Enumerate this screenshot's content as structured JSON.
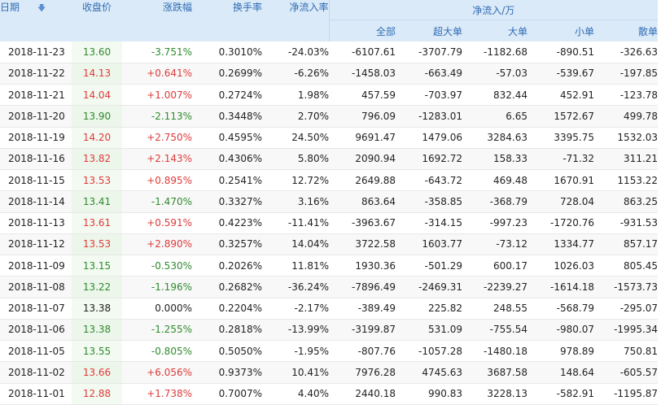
{
  "headers": {
    "date": "日期",
    "close": "收盘价",
    "change": "涨跌幅",
    "turnover": "换手率",
    "net_ratio": "净流入率",
    "net_group": "净流入/万",
    "all": "全部",
    "xl": "超大单",
    "l": "大单",
    "s": "小单",
    "retail": "散单"
  },
  "sort_icon": "down-arrow-icon",
  "colors": {
    "up": "#e03a3a",
    "down": "#2f8a2f",
    "header_bg": "#dbeaf8",
    "header_text": "#2f6cb4"
  },
  "rows": [
    {
      "date": "2018-11-23",
      "close": "13.60",
      "change": "-3.751%",
      "turnover": "0.3010%",
      "net_ratio": "-24.03%",
      "all": "-6107.61",
      "xl": "-3707.79",
      "l": "-1182.68",
      "s": "-890.51",
      "retail": "-326.63",
      "trend": "down"
    },
    {
      "date": "2018-11-22",
      "close": "14.13",
      "change": "+0.641%",
      "turnover": "0.2699%",
      "net_ratio": "-6.26%",
      "all": "-1458.03",
      "xl": "-663.49",
      "l": "-57.03",
      "s": "-539.67",
      "retail": "-197.85",
      "trend": "up"
    },
    {
      "date": "2018-11-21",
      "close": "14.04",
      "change": "+1.007%",
      "turnover": "0.2724%",
      "net_ratio": "1.98%",
      "all": "457.59",
      "xl": "-703.97",
      "l": "832.44",
      "s": "452.91",
      "retail": "-123.78",
      "trend": "up"
    },
    {
      "date": "2018-11-20",
      "close": "13.90",
      "change": "-2.113%",
      "turnover": "0.3448%",
      "net_ratio": "2.70%",
      "all": "796.09",
      "xl": "-1283.01",
      "l": "6.65",
      "s": "1572.67",
      "retail": "499.78",
      "trend": "down"
    },
    {
      "date": "2018-11-19",
      "close": "14.20",
      "change": "+2.750%",
      "turnover": "0.4595%",
      "net_ratio": "24.50%",
      "all": "9691.47",
      "xl": "1479.06",
      "l": "3284.63",
      "s": "3395.75",
      "retail": "1532.03",
      "trend": "up"
    },
    {
      "date": "2018-11-16",
      "close": "13.82",
      "change": "+2.143%",
      "turnover": "0.4306%",
      "net_ratio": "5.80%",
      "all": "2090.94",
      "xl": "1692.72",
      "l": "158.33",
      "s": "-71.32",
      "retail": "311.21",
      "trend": "up"
    },
    {
      "date": "2018-11-15",
      "close": "13.53",
      "change": "+0.895%",
      "turnover": "0.2541%",
      "net_ratio": "12.72%",
      "all": "2649.88",
      "xl": "-643.72",
      "l": "469.48",
      "s": "1670.91",
      "retail": "1153.22",
      "trend": "up"
    },
    {
      "date": "2018-11-14",
      "close": "13.41",
      "change": "-1.470%",
      "turnover": "0.3327%",
      "net_ratio": "3.16%",
      "all": "863.64",
      "xl": "-358.85",
      "l": "-368.79",
      "s": "728.04",
      "retail": "863.25",
      "trend": "down"
    },
    {
      "date": "2018-11-13",
      "close": "13.61",
      "change": "+0.591%",
      "turnover": "0.4223%",
      "net_ratio": "-11.41%",
      "all": "-3963.67",
      "xl": "-314.15",
      "l": "-997.23",
      "s": "-1720.76",
      "retail": "-931.53",
      "trend": "up"
    },
    {
      "date": "2018-11-12",
      "close": "13.53",
      "change": "+2.890%",
      "turnover": "0.3257%",
      "net_ratio": "14.04%",
      "all": "3722.58",
      "xl": "1603.77",
      "l": "-73.12",
      "s": "1334.77",
      "retail": "857.17",
      "trend": "up"
    },
    {
      "date": "2018-11-09",
      "close": "13.15",
      "change": "-0.530%",
      "turnover": "0.2026%",
      "net_ratio": "11.81%",
      "all": "1930.36",
      "xl": "-501.29",
      "l": "600.17",
      "s": "1026.03",
      "retail": "805.45",
      "trend": "down"
    },
    {
      "date": "2018-11-08",
      "close": "13.22",
      "change": "-1.196%",
      "turnover": "0.2682%",
      "net_ratio": "-36.24%",
      "all": "-7896.49",
      "xl": "-2469.31",
      "l": "-2239.27",
      "s": "-1614.18",
      "retail": "-1573.73",
      "trend": "down"
    },
    {
      "date": "2018-11-07",
      "close": "13.38",
      "change": "0.000%",
      "turnover": "0.2204%",
      "net_ratio": "-2.17%",
      "all": "-389.49",
      "xl": "225.82",
      "l": "248.55",
      "s": "-568.79",
      "retail": "-295.07",
      "trend": "flat"
    },
    {
      "date": "2018-11-06",
      "close": "13.38",
      "change": "-1.255%",
      "turnover": "0.2818%",
      "net_ratio": "-13.99%",
      "all": "-3199.87",
      "xl": "531.09",
      "l": "-755.54",
      "s": "-980.07",
      "retail": "-1995.34",
      "trend": "down"
    },
    {
      "date": "2018-11-05",
      "close": "13.55",
      "change": "-0.805%",
      "turnover": "0.5050%",
      "net_ratio": "-1.95%",
      "all": "-807.76",
      "xl": "-1057.28",
      "l": "-1480.18",
      "s": "978.89",
      "retail": "750.81",
      "trend": "down"
    },
    {
      "date": "2018-11-02",
      "close": "13.66",
      "change": "+6.056%",
      "turnover": "0.9373%",
      "net_ratio": "10.41%",
      "all": "7976.28",
      "xl": "4745.63",
      "l": "3687.58",
      "s": "148.64",
      "retail": "-605.57",
      "trend": "up"
    },
    {
      "date": "2018-11-01",
      "close": "12.88",
      "change": "+1.738%",
      "turnover": "0.7007%",
      "net_ratio": "4.40%",
      "all": "2440.18",
      "xl": "990.83",
      "l": "3228.13",
      "s": "-582.91",
      "retail": "-1195.87",
      "trend": "up"
    }
  ]
}
